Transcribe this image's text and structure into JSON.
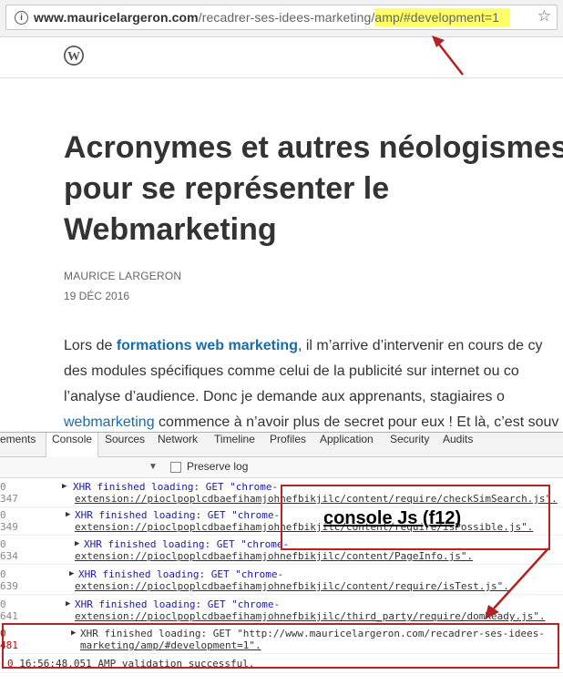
{
  "browser": {
    "url_domain": "www.mauricelargeron.com",
    "url_path": "/recadrer-ses-idees-marketing/",
    "url_highlight": "amp/#development=1",
    "info_icon": "info-icon",
    "star_icon": "star-icon"
  },
  "site": {
    "logo_icon": "wordpress-logo-icon"
  },
  "article": {
    "title_line1": "Acronymes et autres néologismes",
    "title_line2": "pour se représenter le",
    "title_line3": "Webmarketing",
    "author": "MAURICE LARGERON",
    "date": "19 DÉC 2016",
    "p1_pre": "Lors de ",
    "p1_link": "formations web marketing",
    "p1_post": ", il m’arrive d’intervenir  en cours de cy",
    "p2": "des modules spécifiques comme celui de la publicité sur internet ou co",
    "p3": "l’analyse  d’audience.  Donc  je  demande  aux  apprenants,  stagiaires  o",
    "p4_link": "webmarketing",
    "p4_post": " commence à n’avoir plus de secret pour eux ! Et là, c’est souv"
  },
  "devtools": {
    "tabs": [
      "ements",
      "Console",
      "Sources",
      "Network",
      "Timeline",
      "Profiles",
      "Application",
      "Security",
      "Audits"
    ],
    "active_tab": "Console",
    "preserve_log": "Preserve log",
    "rows": [
      {
        "num": "347",
        "line1": "XHR finished loading: GET \"chrome-",
        "line2": "extension://pioclpoplcdbaefihamjohnefbikjilc/content/require/checkSimSearch.js\"."
      },
      {
        "num": "349",
        "line1": "XHR finished loading: GET \"chrome-",
        "line2": "extension://pioclpoplcdbaefihamjohnefbikjilc/content/require/isPossible.js\"."
      },
      {
        "num": "634",
        "line1": "XHR finished loading: GET \"chrome-",
        "line2": "extension://pioclpoplcdbaefihamjohnefbikjilc/content/PageInfo.js\"."
      },
      {
        "num": "639",
        "line1": "XHR finished loading: GET \"chrome-",
        "line2": "extension://pioclpoplcdbaefihamjohnefbikjilc/content/require/isTest.js\"."
      },
      {
        "num": "641",
        "line1": "XHR finished loading: GET \"chrome-",
        "line2": "extension://pioclpoplcdbaefihamjohnefbikjilc/third_party/require/domReady.js\"."
      },
      {
        "num": "481",
        "line1": "XHR finished loading: GET \"http://www.mauricelargeron.com/recadrer-ses-idees-",
        "line2": "marketing/amp/#development=1\"."
      }
    ],
    "last_time": "16:56:48.051",
    "last_msg": "AMP validation successful."
  },
  "annotations": {
    "console_label": "console Js (f12)",
    "arrow_color": "#b22222"
  }
}
